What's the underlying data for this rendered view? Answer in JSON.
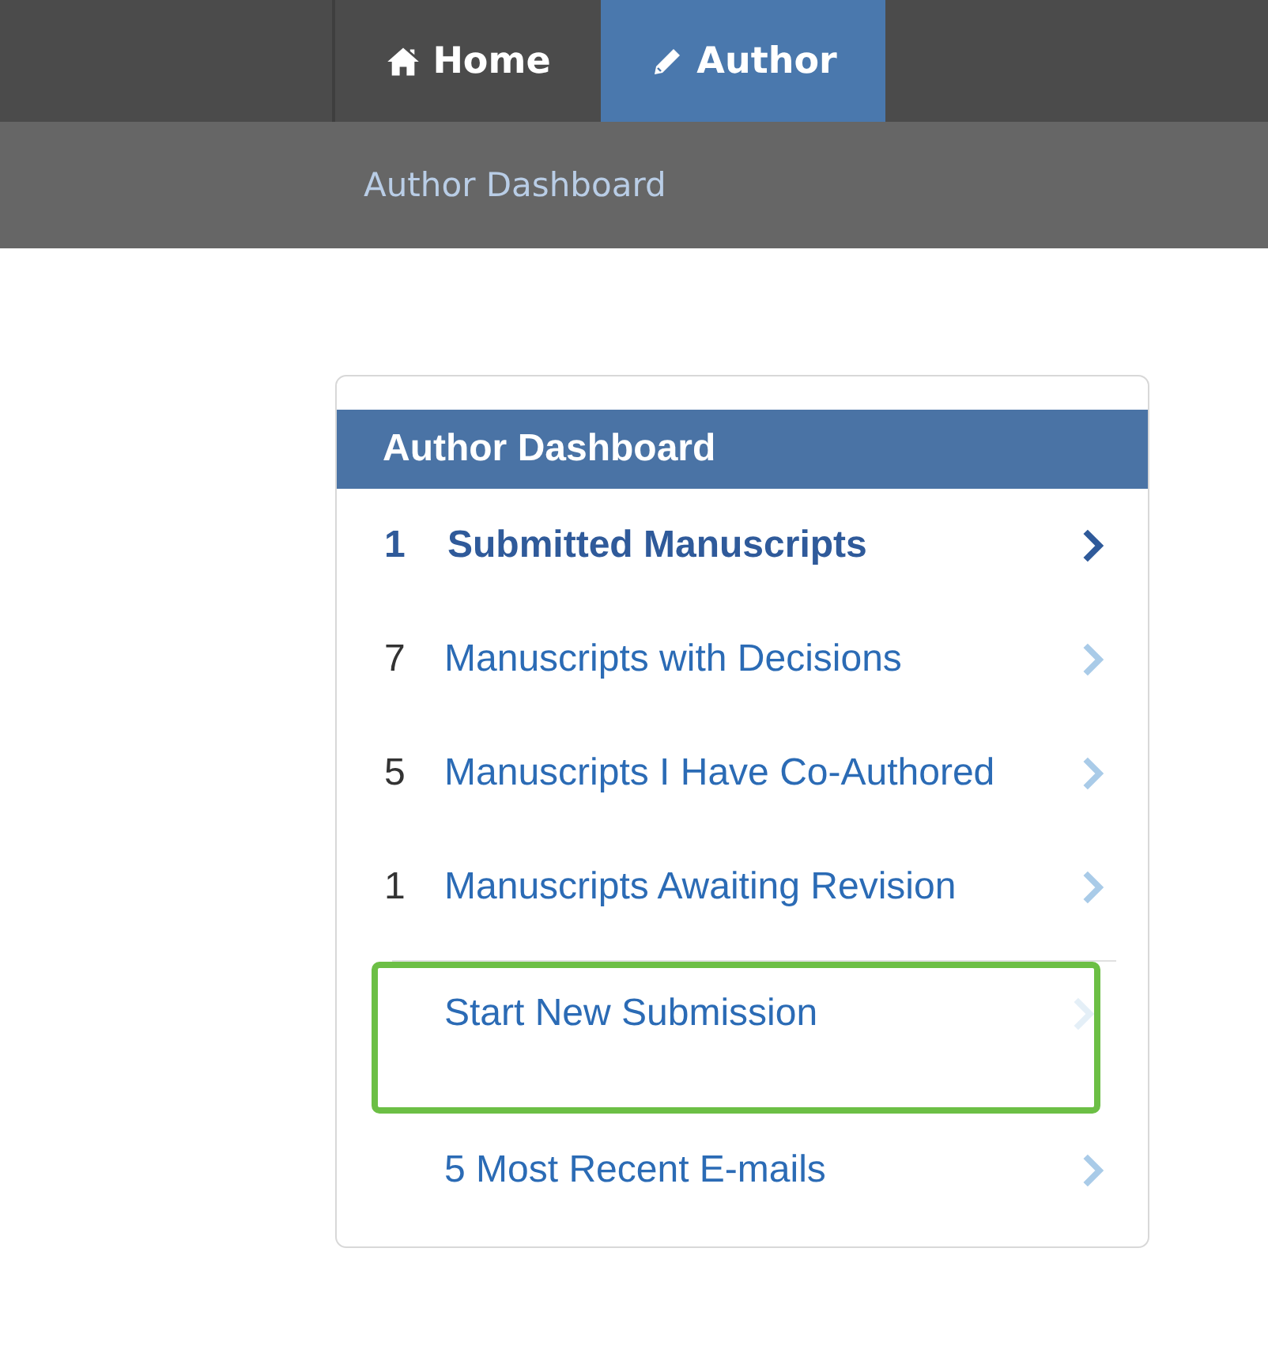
{
  "nav": {
    "tabs": [
      {
        "label": "Home",
        "kind": "home",
        "selected": false
      },
      {
        "label": "Author",
        "kind": "author",
        "selected": true
      }
    ]
  },
  "subnav": {
    "label": "Author Dashboard"
  },
  "panel": {
    "title": "Author Dashboard",
    "items": [
      {
        "count": "1",
        "label": "Submitted Manuscripts",
        "selected": true,
        "highlighted": false
      },
      {
        "count": "7",
        "label": "Manuscripts with Decisions",
        "selected": false,
        "highlighted": false
      },
      {
        "count": "5",
        "label": "Manuscripts I Have Co-Authored",
        "selected": false,
        "highlighted": false
      },
      {
        "count": "1",
        "label": "Manuscripts Awaiting Revision",
        "selected": false,
        "highlighted": false
      },
      {
        "label": "Start New Submission",
        "selected": false,
        "highlighted": true
      },
      {
        "label": "5 Most Recent E-mails",
        "selected": false,
        "highlighted": false
      }
    ]
  }
}
